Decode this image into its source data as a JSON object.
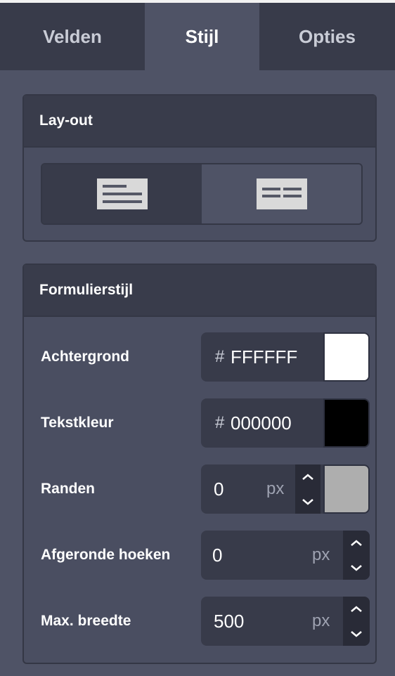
{
  "tabs": [
    {
      "label": "Velden",
      "active": false
    },
    {
      "label": "Stijl",
      "active": true
    },
    {
      "label": "Opties",
      "active": false
    }
  ],
  "layout_panel": {
    "title": "Lay-out",
    "options": [
      {
        "name": "stacked-layout-icon",
        "selected": true
      },
      {
        "name": "inline-layout-icon",
        "selected": false
      }
    ]
  },
  "form_style_panel": {
    "title": "Formulierstijl",
    "background": {
      "label": "Achtergrond",
      "hash": "#",
      "value": "FFFFFF",
      "swatch": "#FFFFFF"
    },
    "text_color": {
      "label": "Tekstkleur",
      "hash": "#",
      "value": "000000",
      "swatch": "#000000"
    },
    "borders": {
      "label": "Randen",
      "value": "0",
      "unit": "px",
      "swatch": "#AEAEAE"
    },
    "rounded_corners": {
      "label": "Afgeronde hoeken",
      "value": "0",
      "unit": "px"
    },
    "max_width": {
      "label": "Max. breedte",
      "value": "500",
      "unit": "px"
    }
  },
  "colors": {
    "background": "#4f5366",
    "tab_inactive": "#383b4a",
    "panel_header": "#393c4b",
    "field": "#383b4a",
    "stepper": "#292b37"
  }
}
